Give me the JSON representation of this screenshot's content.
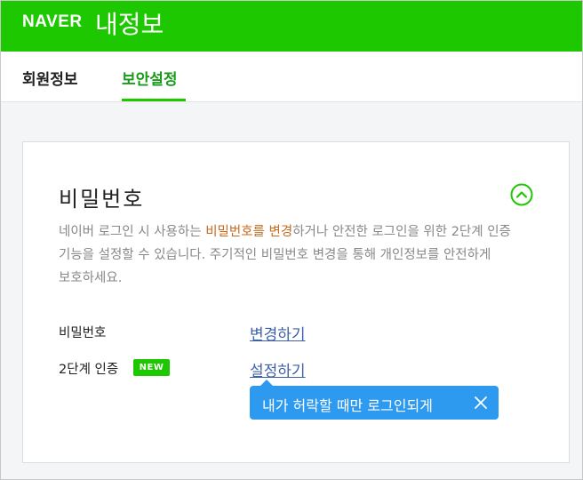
{
  "header": {
    "logo": "NAVER",
    "title": "내정보"
  },
  "tabs": [
    {
      "label": "회원정보",
      "active": false
    },
    {
      "label": "보안설정",
      "active": true
    }
  ],
  "colors": {
    "brand_green": "#1ec800",
    "active_tab_text": "#1a9a1a",
    "link_blue": "#3d5fa8",
    "highlight_orange": "#c86a1e",
    "tooltip_blue": "#2d9aef"
  },
  "password_section": {
    "title": "비밀번호",
    "collapse_icon": "chevron-up-circle-icon",
    "description": {
      "before": "네이버 로그인 시 사용하는 ",
      "highlight": "비밀번호를 변경",
      "after": "하거나 안전한 로그인을 위한 2단계 인증 기능을 설정할 수 있습니다. 주기적인 비밀번호 변경을 통해 개인정보를 안전하게 보호하세요."
    },
    "rows": [
      {
        "label": "비밀번호",
        "action": "변경하기"
      },
      {
        "label": "2단계 인증",
        "badge": "NEW",
        "action": "설정하기"
      }
    ],
    "tooltip": {
      "text": "내가 허락할 때만 로그인되게",
      "close_icon": "close-icon"
    }
  }
}
